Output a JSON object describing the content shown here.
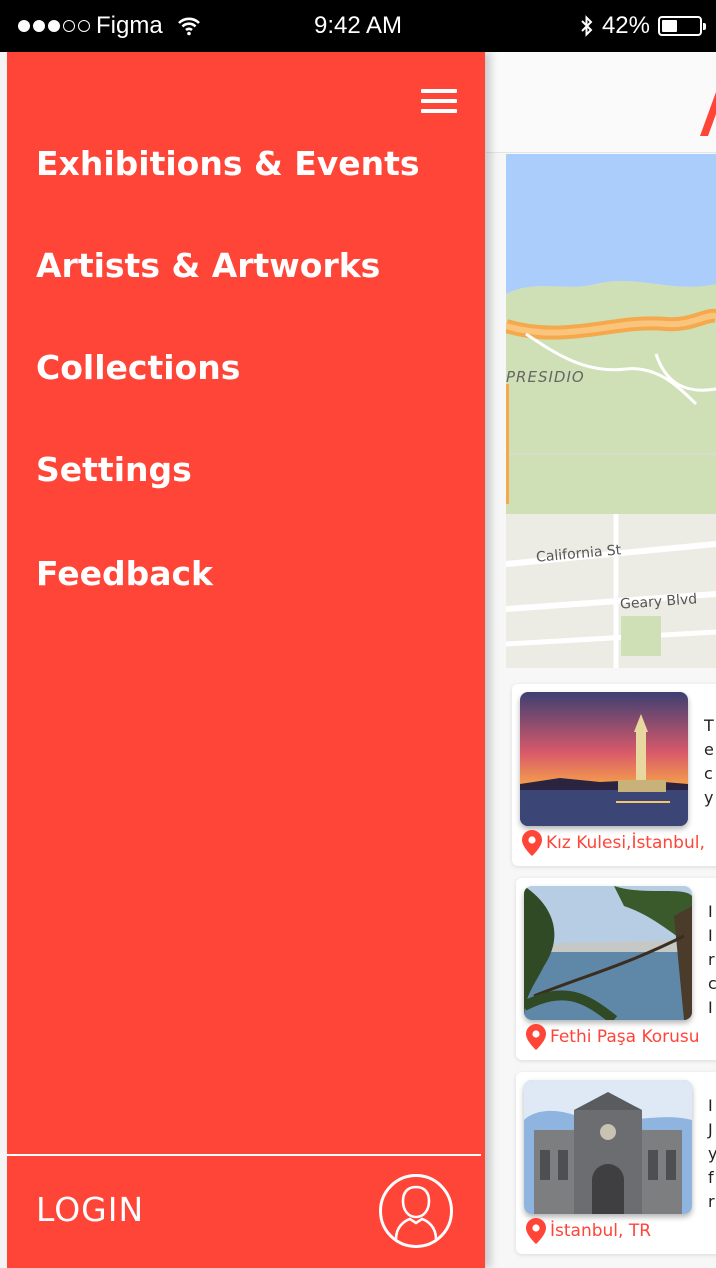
{
  "status_bar": {
    "carrier": "Figma",
    "time": "9:42 AM",
    "battery": "42%",
    "battery_level": 0.42,
    "signal_dots": [
      1,
      1,
      1,
      0,
      0
    ]
  },
  "drawer": {
    "background": "#ff4438",
    "menu_items": [
      {
        "label": "Exhibitions & Events"
      },
      {
        "label": "Artists & Artworks"
      },
      {
        "label": "Collections"
      },
      {
        "label": "Settings"
      },
      {
        "label": "Feedback"
      }
    ],
    "login_label": "LOGIN",
    "icons": {
      "menu": "hamburger-icon",
      "profile": "user-icon"
    }
  },
  "map": {
    "labels": [
      "PRESIDIO",
      "California St",
      "Geary Blvd"
    ]
  },
  "places": [
    {
      "location": "Kız Kulesi,İstanbul,",
      "text": [
        "T",
        "e",
        "c",
        "y"
      ]
    },
    {
      "location": "Fethi Paşa Korusu",
      "text": [
        "I",
        "I",
        "r",
        "c",
        "I"
      ]
    },
    {
      "location": "İstanbul, TR",
      "text": [
        "I",
        "J",
        "y",
        "f",
        "r"
      ]
    }
  ]
}
